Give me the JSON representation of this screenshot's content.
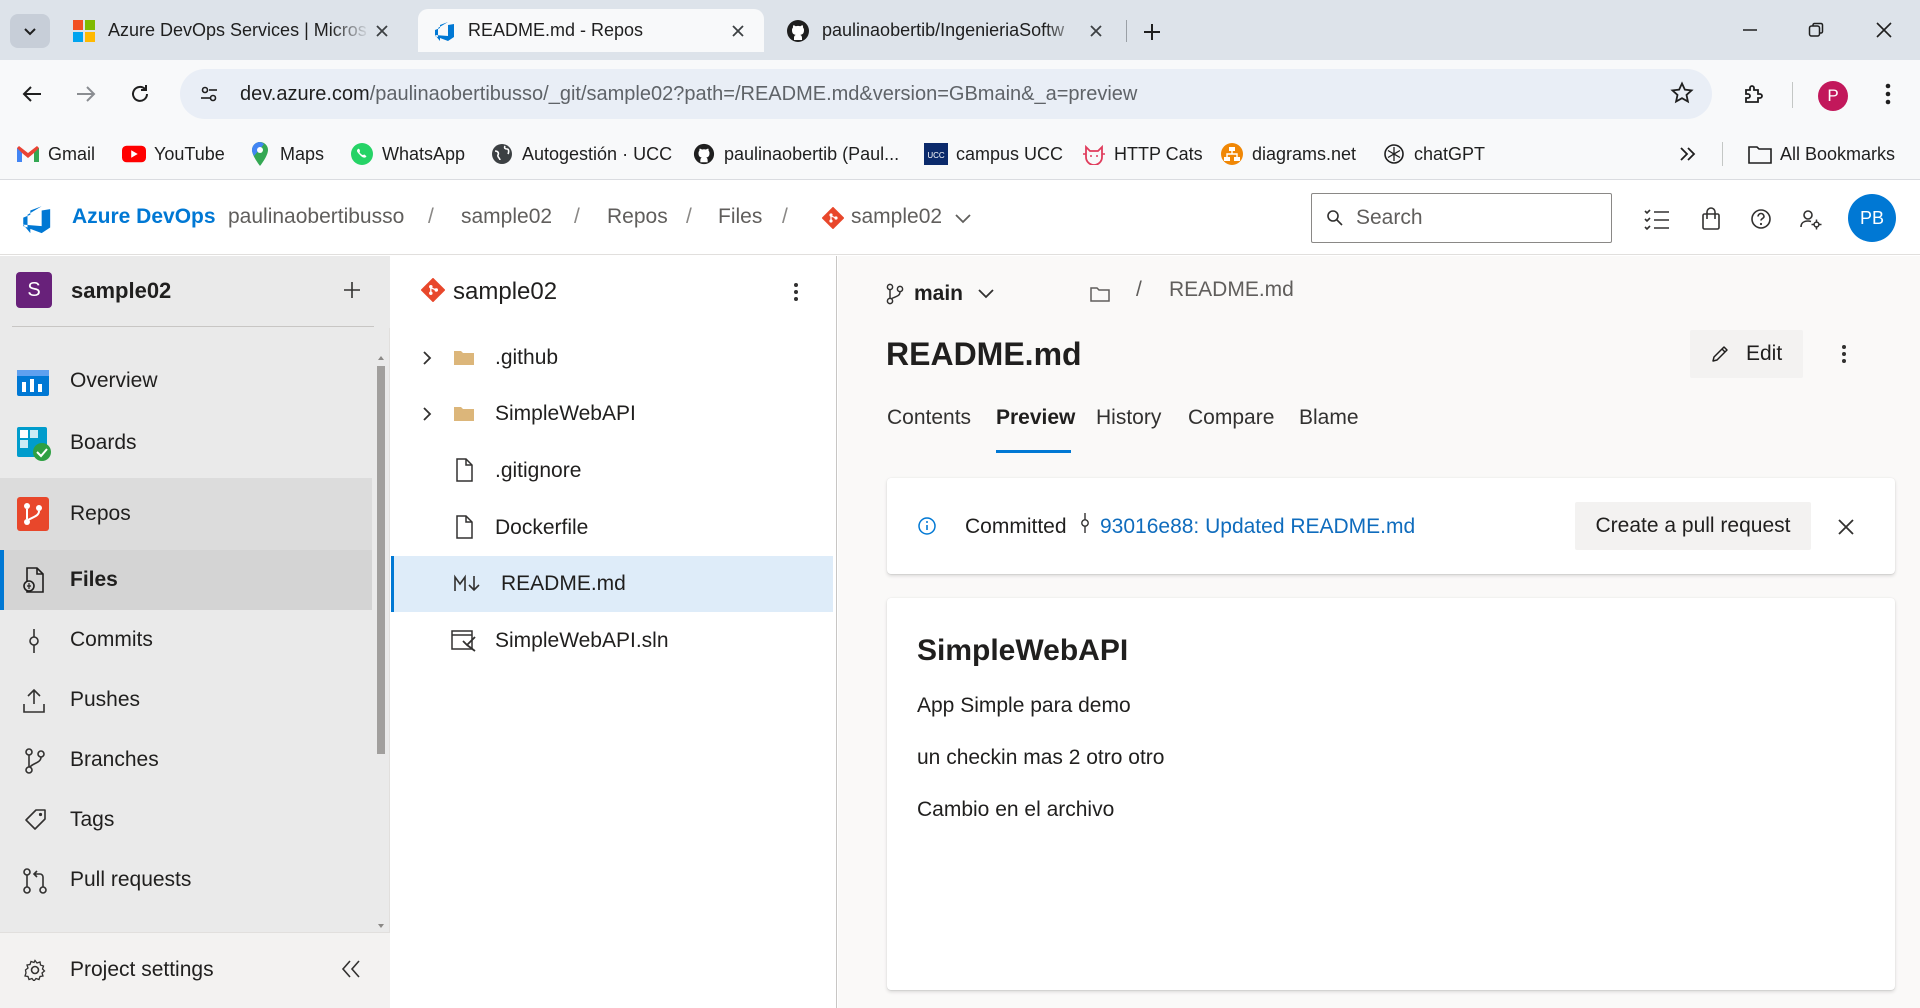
{
  "browser": {
    "tabs": [
      {
        "title": "Azure DevOps Services | Micros",
        "icon": "microsoft-logo"
      },
      {
        "title": "README.md - Repos",
        "icon": "azure-devops-logo"
      },
      {
        "title": "paulinaobertib/IngenieriaSoftw",
        "icon": "github-logo"
      }
    ],
    "url_host": "dev.azure.com",
    "url_path": "/paulinaobertibusso/_git/sample02?path=/README.md&version=GBmain&_a=preview",
    "profile_initial": "P",
    "bookmarks": [
      "Gmail",
      "YouTube",
      "Maps",
      "WhatsApp",
      "Autogestión · UCC",
      "paulinaobertib (Paul...",
      "campus UCC",
      "HTTP Cats",
      "diagrams.net",
      "chatGPT"
    ],
    "all_bookmarks": "All Bookmarks"
  },
  "header": {
    "brand": "Azure DevOps",
    "breadcrumb": [
      "paulinaobertibusso",
      "sample02",
      "Repos",
      "Files",
      "sample02"
    ],
    "search_placeholder": "Search",
    "avatar_initials": "PB"
  },
  "sidebar": {
    "project_initial": "S",
    "project_name": "sample02",
    "items": [
      {
        "label": "Overview",
        "icon": "overview-icon"
      },
      {
        "label": "Boards",
        "icon": "boards-icon"
      },
      {
        "label": "Repos",
        "icon": "repos-icon"
      },
      {
        "label": "Files",
        "icon": "files-icon"
      },
      {
        "label": "Commits",
        "icon": "commits-icon"
      },
      {
        "label": "Pushes",
        "icon": "pushes-icon"
      },
      {
        "label": "Branches",
        "icon": "branches-icon"
      },
      {
        "label": "Tags",
        "icon": "tags-icon"
      },
      {
        "label": "Pull requests",
        "icon": "pull-requests-icon"
      }
    ],
    "project_settings": "Project settings"
  },
  "filetree": {
    "repo_name": "sample02",
    "items": [
      {
        "name": ".github",
        "type": "folder"
      },
      {
        "name": "SimpleWebAPI",
        "type": "folder"
      },
      {
        "name": ".gitignore",
        "type": "file"
      },
      {
        "name": "Dockerfile",
        "type": "file"
      },
      {
        "name": "README.md",
        "type": "markdown",
        "selected": true
      },
      {
        "name": "SimpleWebAPI.sln",
        "type": "solution"
      }
    ]
  },
  "main": {
    "branch": "main",
    "path_file": "README.md",
    "file_title": "README.md",
    "edit_label": "Edit",
    "tabs": [
      "Contents",
      "Preview",
      "History",
      "Compare",
      "Blame"
    ],
    "active_tab": "Preview",
    "commit_banner": {
      "prefix": "Committed",
      "commit_link": "93016e88: Updated README.md",
      "pr_button": "Create a pull request"
    },
    "preview": {
      "heading": "SimpleWebAPI",
      "paragraphs": [
        "App Simple para demo",
        "un checkin mas 2 otro otro",
        "Cambio en el archivo"
      ]
    }
  },
  "colors": {
    "accent": "#0078d4",
    "link": "#0f6cbd",
    "selected_row": "#deecf9",
    "project_badge": "#68217a"
  }
}
